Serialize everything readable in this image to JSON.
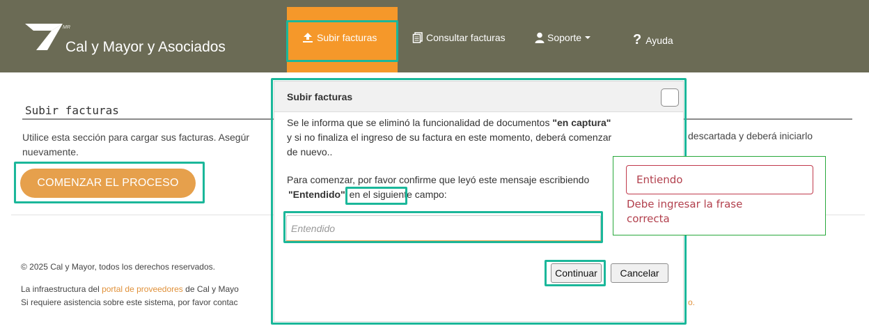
{
  "brand": {
    "name": "Cal y Mayor y Asociados",
    "mark": "MR"
  },
  "nav": {
    "items": [
      {
        "label": "Subir facturas",
        "icon": "upload-icon",
        "active": true
      },
      {
        "label": "Consultar facturas",
        "icon": "documents-icon"
      },
      {
        "label": "Soporte",
        "icon": "user-icon",
        "caret": "chevron-down-icon"
      },
      {
        "label": "Ayuda",
        "icon": "question-icon",
        "icon_glyph": "?"
      }
    ]
  },
  "page": {
    "title": "Subir facturas",
    "intro_left": "Utilice esta sección para cargar sus facturas. Asegúr",
    "intro_left_2": "nuevamente.",
    "intro_right": "descartada y deberá iniciarlo",
    "start_button": "COMENZAR EL PROCESO"
  },
  "footer": {
    "copyright": "© 2025 Cal y Mayor, todos los derechos reservados.",
    "line1_prefix": "La infraestructura del ",
    "line1_link": "portal de proveedores",
    "line1_suffix": " de Cal y Mayo",
    "line2": "Si requiere asistencia sobre este sistema, por favor contac",
    "line2_right": "o."
  },
  "modal": {
    "title": "Subir facturas",
    "p1_a": "Se le informa que se eliminó la funcionalidad de documentos ",
    "p1_bold": "\"en captura\"",
    "p1_b": " y si no finaliza el ingreso de su factura en este momento, deberá comenzar de nuevo..",
    "p2_a": "Para comenzar, por favor confirme que leyó este mensaje escribiendo ",
    "p2_bold": "\"Entendido\"",
    "p2_b": " en el siguiente campo:",
    "input_placeholder": "Entendido",
    "input_value": "",
    "continue_label": "Continuar",
    "cancel_label": "Cancelar"
  },
  "validation": {
    "value": "Entiendo",
    "error": "Debe ingresar la frase correcta"
  },
  "colors": {
    "navbar": "#6b6b55",
    "active_tab": "#f5982a",
    "accent_button": "#e6a04c",
    "highlight": "#1bb79a",
    "error": "#b2404d"
  }
}
